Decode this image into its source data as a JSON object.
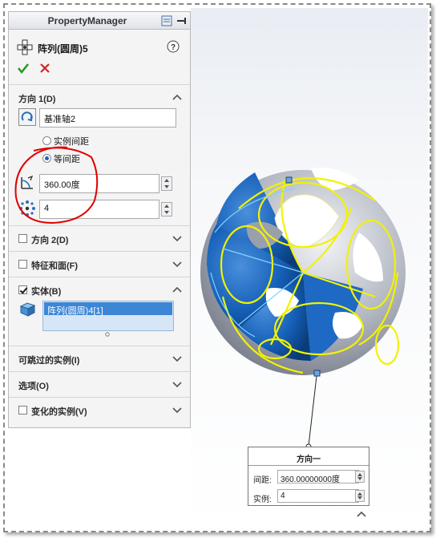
{
  "property_manager": {
    "header_title": "PropertyManager",
    "feature_title": "阵列(圆周)5",
    "help_icon": "help-icon",
    "ok_icon": "ok-check-icon",
    "cancel_icon": "cancel-x-icon"
  },
  "direction1": {
    "label": "方向 1(D)",
    "axis_value": "基准轴2",
    "option_instance_spacing": "实例间距",
    "option_equal_spacing": "等间距",
    "selected_option": "等间距",
    "angle_value": "360.00度",
    "instances_value": "4"
  },
  "direction2": {
    "label": "方向 2(D)",
    "checked": false
  },
  "features_faces": {
    "label": "特征和面(F)",
    "checked": false
  },
  "bodies": {
    "label": "实体(B)",
    "checked": true,
    "selected_item": "阵列(圆周)4[1]"
  },
  "skip_instances": {
    "label": "可跳过的实例(I)"
  },
  "options": {
    "label": "选项(O)"
  },
  "varied_instances": {
    "label": "变化的实例(V)",
    "checked": false
  },
  "callout": {
    "title": "方向一",
    "spacing_label": "间距:",
    "spacing_value": "360.00000000度",
    "instances_label": "实例:",
    "instances_value": "4"
  },
  "colors": {
    "selection_yellow": "#f2f200",
    "body_blue": "#1560b8",
    "annotation_red": "#e00000",
    "ok_green": "#1e9b1e",
    "cancel_red": "#d62424"
  }
}
